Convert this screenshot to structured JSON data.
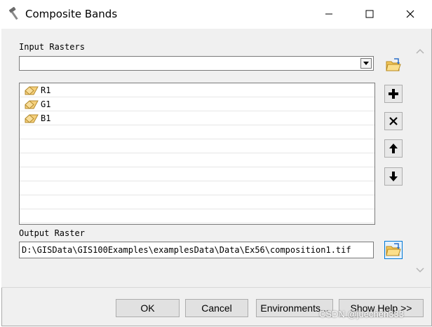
{
  "window": {
    "title": "Composite Bands",
    "icon": "hammer-icon"
  },
  "controls": {
    "minimize": "minimize-icon",
    "maximize": "maximize-icon",
    "close": "close-icon"
  },
  "input_rasters": {
    "label": "Input Rasters",
    "combo_value": "",
    "items": [
      {
        "name": "R1",
        "icon": "raster-layer-icon"
      },
      {
        "name": "G1",
        "icon": "raster-layer-icon"
      },
      {
        "name": "B1",
        "icon": "raster-layer-icon"
      }
    ]
  },
  "side_buttons": [
    "browse-folder-icon",
    "add-icon",
    "remove-icon",
    "move-up-icon",
    "move-down-icon"
  ],
  "output_raster": {
    "label": "Output Raster",
    "value": "D:\\GISData\\GIS100Examples\\examplesData\\Data\\Ex56\\composition1.tif"
  },
  "buttons": {
    "ok": "OK",
    "cancel": "Cancel",
    "environments": "Environments...",
    "show_help": "Show Help >>"
  },
  "watermark": "CSDN @juechen333"
}
